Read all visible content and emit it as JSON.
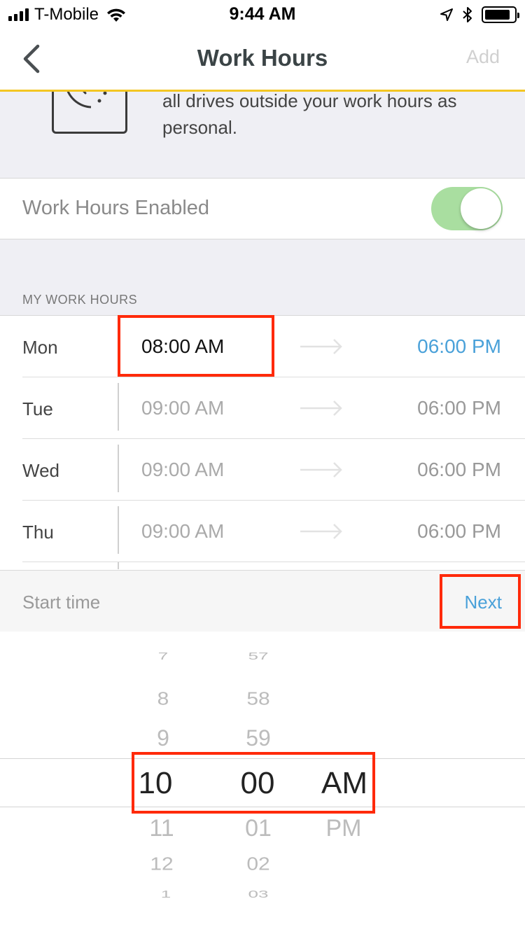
{
  "status_bar": {
    "carrier": "T-Mobile",
    "time": "9:44 AM",
    "signal_bars": 4
  },
  "nav": {
    "title": "Work Hours",
    "add_label": "Add",
    "back_icon": "chevron-left-icon"
  },
  "intro": {
    "text": "all drives outside your work hours as personal.",
    "icon": "clock-icon"
  },
  "toggle": {
    "label": "Work Hours Enabled",
    "enabled": true,
    "on_color": "#a9dea0"
  },
  "section": {
    "header": "MY WORK HOURS"
  },
  "hours": [
    {
      "day": "Mon",
      "start": "08:00 AM",
      "end": "06:00 PM",
      "active": true
    },
    {
      "day": "Tue",
      "start": "09:00 AM",
      "end": "06:00 PM",
      "active": false
    },
    {
      "day": "Wed",
      "start": "09:00 AM",
      "end": "06:00 PM",
      "active": false
    },
    {
      "day": "Thu",
      "start": "09:00 AM",
      "end": "06:00 PM",
      "active": false
    }
  ],
  "picker_bar": {
    "title": "Start time",
    "next_label": "Next"
  },
  "picker": {
    "hours_above": [
      "7",
      "8",
      "9"
    ],
    "hours_below": [
      "11",
      "12",
      "1"
    ],
    "minutes_above": [
      "57",
      "58",
      "59"
    ],
    "minutes_below": [
      "01",
      "02",
      "03"
    ],
    "period_below": [
      "PM"
    ],
    "selected": {
      "hour": "10",
      "minute": "00",
      "period": "AM"
    }
  },
  "colors": {
    "accent": "#4aa1d9",
    "nav_border": "#f3c623",
    "highlight": "#ff2a0a",
    "section_bg": "#efeff4"
  }
}
